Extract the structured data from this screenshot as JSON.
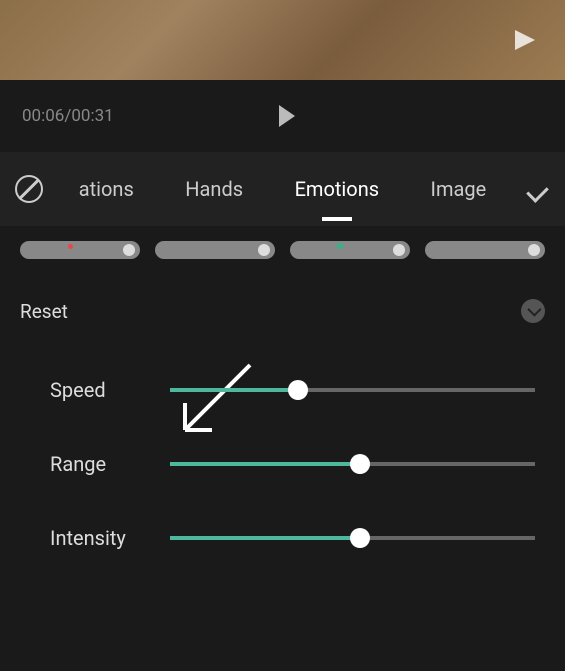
{
  "playback": {
    "current_time": "00:06",
    "total_time": "00:31",
    "time_display": "00:06/00:31"
  },
  "tabs": {
    "items": [
      {
        "label": "ations"
      },
      {
        "label": "Hands"
      },
      {
        "label": "Emotions"
      },
      {
        "label": "Image"
      }
    ],
    "active_index": 2
  },
  "controls": {
    "reset_label": "Reset"
  },
  "sliders": [
    {
      "label": "Speed",
      "value": 35
    },
    {
      "label": "Range",
      "value": 52
    },
    {
      "label": "Intensity",
      "value": 52
    }
  ],
  "colors": {
    "slider_fill": "#4db89e",
    "background": "#1a1a1a"
  }
}
